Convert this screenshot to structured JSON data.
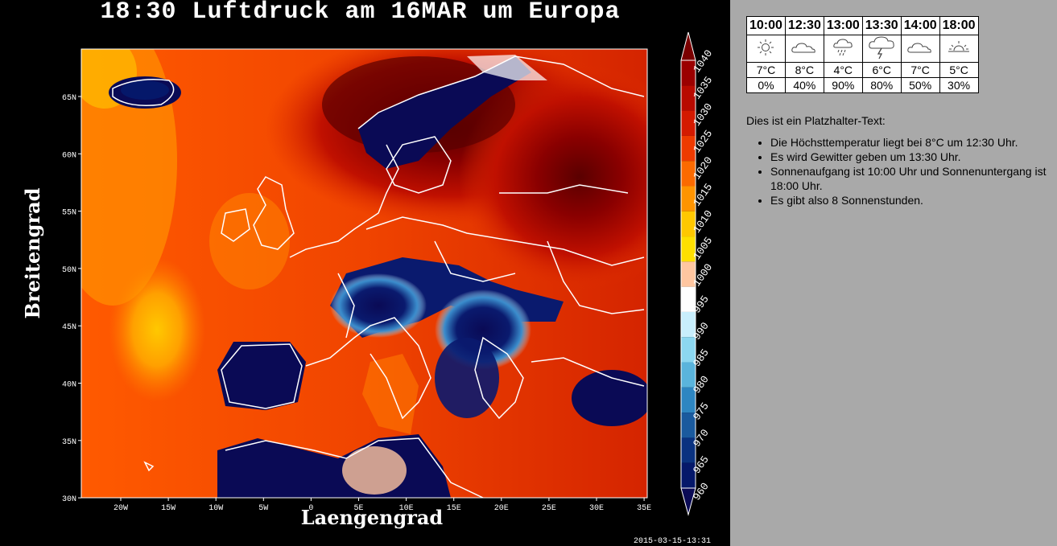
{
  "map": {
    "title": "18:30 Luftdruck am 16MAR um Europa",
    "xlabel": "Laengengrad",
    "ylabel": "Breitengrad",
    "lon_ticks": [
      "20W",
      "15W",
      "10W",
      "5W",
      "0",
      "5E",
      "10E",
      "15E",
      "20E",
      "25E",
      "30E",
      "35E"
    ],
    "lat_ticks": [
      "65N",
      "60N",
      "55N",
      "50N",
      "45N",
      "40N",
      "35N",
      "30N"
    ],
    "colorbar_levels": [
      "1040",
      "1035",
      "1030",
      "1025",
      "1020",
      "1015",
      "1010",
      "1005",
      "1000",
      "995",
      "990",
      "985",
      "980",
      "975",
      "970",
      "965",
      "960"
    ],
    "colorbar_colors": [
      "#7a0000",
      "#9b0000",
      "#b80a00",
      "#d41a00",
      "#ee3a00",
      "#fb6a00",
      "#ff9400",
      "#ffc800",
      "#ffe000",
      "#ffc6a0",
      "#ffffff",
      "#c8eefc",
      "#8cd7f0",
      "#5ab4dc",
      "#2e86c1",
      "#1a5a9e",
      "#0a3280",
      "#05186a",
      "#0a0a55"
    ],
    "timestamp": "2015-03-15-13:31"
  },
  "forecast": {
    "times": [
      "10:00",
      "12:30",
      "13:00",
      "13:30",
      "14:00",
      "18:00"
    ],
    "icons": [
      "sun-icon",
      "cloud-icon",
      "rain-icon",
      "thunderstorm-icon",
      "cloud-icon",
      "sunset-icon"
    ],
    "temps": [
      "7°C",
      "8°C",
      "4°C",
      "6°C",
      "7°C",
      "5°C"
    ],
    "precip": [
      "0%",
      "40%",
      "90%",
      "80%",
      "50%",
      "30%"
    ]
  },
  "info": {
    "intro": "Dies ist ein Platzhalter-Text:",
    "bullets": [
      "Die Höchsttemperatur liegt bei 8°C um 12:30 Uhr.",
      "Es wird Gewitter geben um 13:30 Uhr.",
      "Sonnenaufgang ist 10:00 Uhr und Sonnenuntergang ist 18:00 Uhr.",
      "Es gibt also 8 Sonnenstunden."
    ]
  }
}
